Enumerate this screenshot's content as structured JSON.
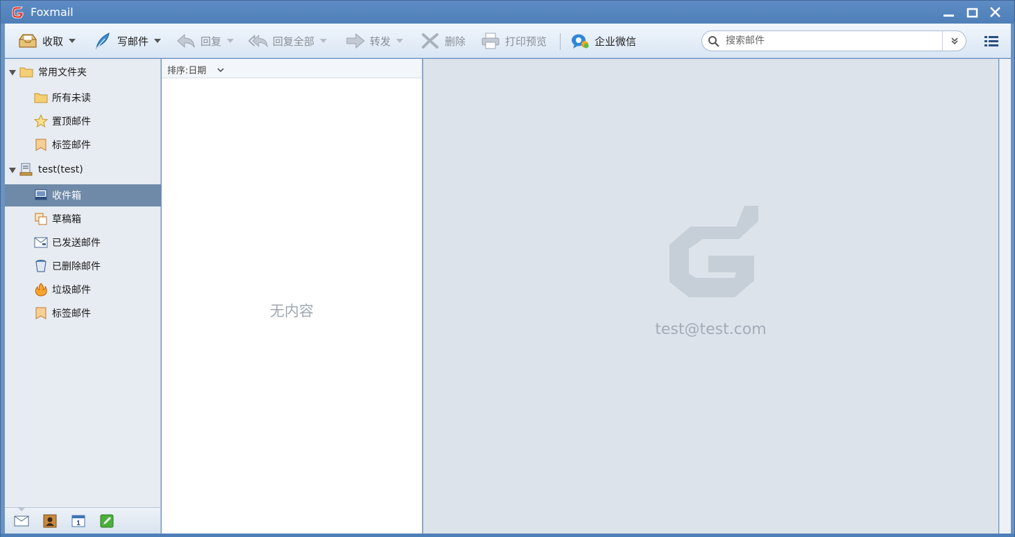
{
  "window": {
    "title": "Foxmail"
  },
  "toolbar": {
    "receive": "收取",
    "compose": "写邮件",
    "reply": "回复",
    "reply_all": "回复全部",
    "forward": "转发",
    "delete": "删除",
    "print_preview": "打印预览",
    "wecom": "企业微信"
  },
  "search": {
    "placeholder": "搜索邮件"
  },
  "sidebar": {
    "common_group": "常用文件夹",
    "common_items": [
      "所有未读",
      "置顶邮件",
      "标签邮件"
    ],
    "account": "test(test)",
    "account_items": [
      "收件箱",
      "草稿箱",
      "已发送邮件",
      "已删除邮件",
      "垃圾邮件",
      "标签邮件"
    ],
    "selected": "收件箱"
  },
  "message_list": {
    "sort_label": "排序:日期",
    "empty_text": "无内容"
  },
  "reading_pane": {
    "account_email": "test@test.com"
  },
  "bottom_bar": {
    "calendar_day": "1"
  },
  "colors": {
    "titlebar": "#5d8cc4",
    "selection": "#6f8aa8",
    "reading_bg": "#dce3ea"
  }
}
